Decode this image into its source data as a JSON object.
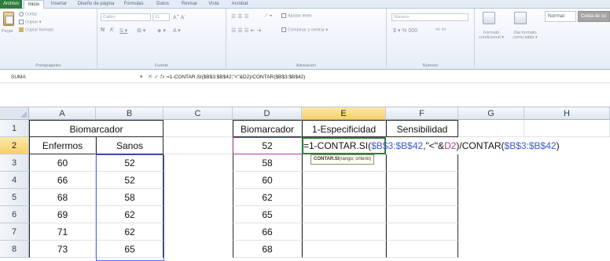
{
  "ribbon": {
    "tabs": [
      "Archivo",
      "Inicio",
      "Insertar",
      "Diseño de página",
      "Fórmulas",
      "Datos",
      "Revisar",
      "Vista",
      "Acrobat"
    ],
    "clipboard": {
      "paste": "Pegar",
      "cut": "Cortar",
      "copy": "Copiar ▾",
      "format_painter": "Copiar formato",
      "label": "Portapapeles"
    },
    "font": {
      "name": "Calibri",
      "size": "11",
      "bold": "N",
      "italic": "K",
      "underline": "S ▾",
      "label": "Fuente"
    },
    "alignment": {
      "wrap": "Ajustar texto",
      "merge": "Combinar y centrar ▾",
      "label": "Alineación"
    },
    "number": {
      "format": "Número",
      "currency": "$ ▾ % 000",
      "decimals": "⁰⁰ ⁰⁰",
      "label": "Número"
    },
    "styles": {
      "conditional": "Formato condicional ▾",
      "as_table": "Dar formato como tabla ▾",
      "normal": "Normal",
      "bad": "Celda de co"
    }
  },
  "formula_bar": {
    "name_box": "SUMA",
    "cancel": "✕",
    "confirm": "✓",
    "fx": "fx",
    "formula": "=1-CONTAR.SI($B$3:$B$42;\"<\"&D2)/CONTAR($B$3:$B$42)"
  },
  "grid": {
    "columns": [
      "A",
      "B",
      "C",
      "D",
      "E",
      "F",
      "G",
      "H"
    ],
    "rows": [
      "1",
      "2",
      "3",
      "4",
      "5",
      "6",
      "7",
      "8"
    ],
    "cells": {
      "A1": "Biomarcador",
      "A2": "Enfermos",
      "B2": "Sanos",
      "D1": "Biomarcador",
      "E1": "1-Especificidad",
      "F1": "Sensibilidad",
      "D2": "52",
      "A3": "60",
      "B3": "52",
      "D3": "58",
      "A4": "66",
      "B4": "52",
      "D4": "60",
      "A5": "68",
      "B5": "58",
      "D5": "62",
      "A6": "69",
      "B6": "62",
      "D6": "65",
      "A7": "71",
      "B7": "62",
      "D7": "66",
      "A8": "73",
      "B8": "65",
      "D8": "68"
    },
    "edit_formula": {
      "prefix": "=1-CONTAR.SI(",
      "range": "$B$3:$B$42",
      "mid": ",\"<\"&",
      "ref": "D2",
      "mid2": ")/CONTAR(",
      "range2": "$B$3:$B$42",
      "suffix": ")"
    },
    "tooltip": {
      "fn": "CONTAR.SI",
      "args": "(rango; criterio)"
    }
  }
}
